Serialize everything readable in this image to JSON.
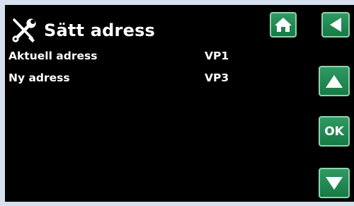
{
  "header": {
    "title": "Sätt adress",
    "icon": "tools-icon"
  },
  "fields": [
    {
      "label": "Aktuell adress",
      "value": "VP1"
    },
    {
      "label": "Ny adress",
      "value": "VP3"
    }
  ],
  "nav": {
    "home_icon": "home-icon",
    "back_icon": "back-arrow-icon",
    "up_icon": "up-arrow-icon",
    "ok_label": "OK",
    "down_icon": "down-arrow-icon"
  },
  "colors": {
    "background": "#000000",
    "button_green": "#1f8a52",
    "button_border": "#8fd3ae",
    "frame": "#d6e0ef",
    "text": "#ffffff"
  }
}
